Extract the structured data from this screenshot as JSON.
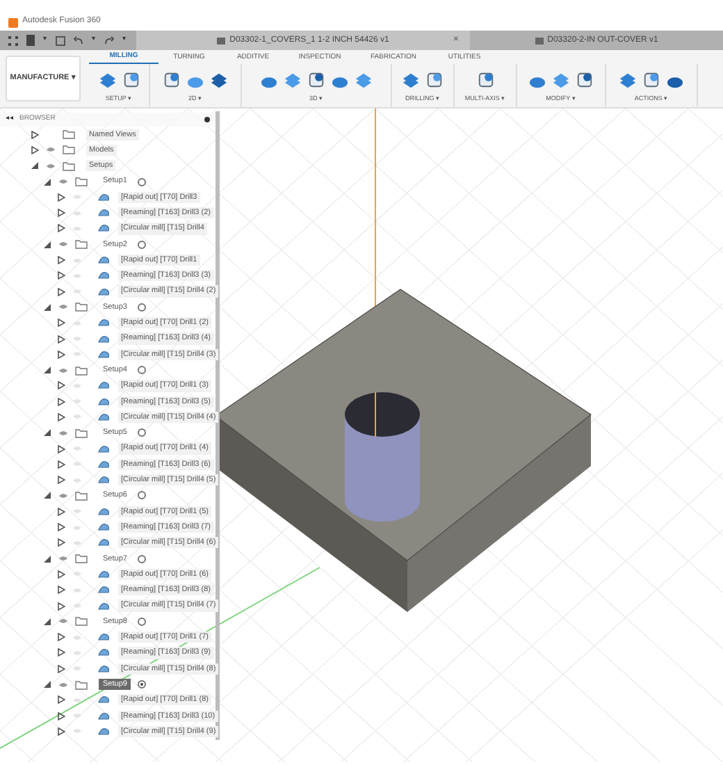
{
  "app_title": "Autodesk Fusion 360",
  "quick_access_carets": [
    "▾",
    "▾",
    "▾"
  ],
  "documents": [
    {
      "title": "D03302-1_COVERS_1 1-2 INCH 54426 v1",
      "selected": true,
      "close": "×"
    },
    {
      "title": "D03320-2-IN OUT-COVER v1",
      "selected": false
    }
  ],
  "workspace": {
    "label": "MANUFACTURE",
    "caret": "▾"
  },
  "tabs": [
    {
      "label": "MILLING",
      "selected": true
    },
    {
      "label": "TURNING",
      "selected": false
    },
    {
      "label": "ADDITIVE",
      "selected": false
    },
    {
      "label": "INSPECTION",
      "selected": false
    },
    {
      "label": "FABRICATION",
      "selected": false
    },
    {
      "label": "UTILITIES",
      "selected": false
    }
  ],
  "tool_groups": [
    {
      "label": "SETUP ▾"
    },
    {
      "label": "2D ▾"
    },
    {
      "label": "3D ▾"
    },
    {
      "label": "DRILLING ▾"
    },
    {
      "label": "MULTI-AXIS ▾"
    },
    {
      "label": "MODIFY ▾"
    },
    {
      "label": "ACTIONS ▾"
    }
  ],
  "browser": {
    "title": "BROWSER",
    "collapse": "◂◂",
    "items": [
      {
        "kind": "folder",
        "label": "Named Views",
        "expanded": false
      },
      {
        "kind": "folder",
        "label": "Models",
        "expanded": false
      },
      {
        "kind": "folder",
        "label": "Setups",
        "expanded": true,
        "children": [
          {
            "kind": "setup",
            "label": "Setup1",
            "expanded": true,
            "selected": false,
            "active": false,
            "children": [
              {
                "kind": "operation",
                "label": "[Rapid out] [T70] Drill3",
                "expanded": false
              },
              {
                "kind": "operation",
                "label": "[Reaming] [T163] Drill3 (2)",
                "expanded": false
              },
              {
                "kind": "operation",
                "label": "[Circular mill] [T15] Drill4",
                "expanded": false
              }
            ]
          },
          {
            "kind": "setup",
            "label": "Setup2",
            "expanded": true,
            "selected": false,
            "active": false,
            "children": [
              {
                "kind": "operation",
                "label": "[Rapid out] [T70] Drill1",
                "expanded": false
              },
              {
                "kind": "operation",
                "label": "[Reaming] [T163] Drill3 (3)",
                "expanded": false
              },
              {
                "kind": "operation",
                "label": "[Circular mill] [T15] Drill4 (2)",
                "expanded": false
              }
            ]
          },
          {
            "kind": "setup",
            "label": "Setup3",
            "expanded": true,
            "selected": false,
            "active": false,
            "children": [
              {
                "kind": "operation",
                "label": "[Rapid out] [T70] Drill1 (2)",
                "expanded": false
              },
              {
                "kind": "operation",
                "label": "[Reaming] [T163] Drill3 (4)",
                "expanded": false
              },
              {
                "kind": "operation",
                "label": "[Circular mill] [T15] Drill4 (3)",
                "expanded": false
              }
            ]
          },
          {
            "kind": "setup",
            "label": "Setup4",
            "expanded": true,
            "selected": false,
            "active": false,
            "children": [
              {
                "kind": "operation",
                "label": "[Rapid out] [T70] Drill1 (3)",
                "expanded": false
              },
              {
                "kind": "operation",
                "label": "[Reaming] [T163] Drill3 (5)",
                "expanded": false
              },
              {
                "kind": "operation",
                "label": "[Circular mill] [T15] Drill4 (4)",
                "expanded": false
              }
            ]
          },
          {
            "kind": "setup",
            "label": "Setup5",
            "expanded": true,
            "selected": false,
            "active": false,
            "children": [
              {
                "kind": "operation",
                "label": "[Rapid out] [T70] Drill1 (4)",
                "expanded": false
              },
              {
                "kind": "operation",
                "label": "[Reaming] [T163] Drill3 (6)",
                "expanded": false
              },
              {
                "kind": "operation",
                "label": "[Circular mill] [T15] Drill4 (5)",
                "expanded": false
              }
            ]
          },
          {
            "kind": "setup",
            "label": "Setup6",
            "expanded": true,
            "selected": false,
            "active": false,
            "children": [
              {
                "kind": "operation",
                "label": "[Rapid out] [T70] Drill1 (5)",
                "expanded": false
              },
              {
                "kind": "operation",
                "label": "[Reaming] [T163] Drill3 (7)",
                "expanded": false
              },
              {
                "kind": "operation",
                "label": "[Circular mill] [T15] Drill4 (6)",
                "expanded": false
              }
            ]
          },
          {
            "kind": "setup",
            "label": "Setup7",
            "expanded": true,
            "selected": false,
            "active": false,
            "children": [
              {
                "kind": "operation",
                "label": "[Rapid out] [T70] Drill1 (6)",
                "expanded": false
              },
              {
                "kind": "operation",
                "label": "[Reaming] [T163] Drill3 (8)",
                "expanded": false
              },
              {
                "kind": "operation",
                "label": "[Circular mill] [T15] Drill4 (7)",
                "expanded": false
              }
            ]
          },
          {
            "kind": "setup",
            "label": "Setup8",
            "expanded": true,
            "selected": false,
            "active": false,
            "children": [
              {
                "kind": "operation",
                "label": "[Rapid out] [T70] Drill1 (7)",
                "expanded": false
              },
              {
                "kind": "operation",
                "label": "[Reaming] [T163] Drill3 (9)",
                "expanded": false
              },
              {
                "kind": "operation",
                "label": "[Circular mill] [T15] Drill4 (8)",
                "expanded": false
              }
            ]
          },
          {
            "kind": "setup",
            "label": "Setup9",
            "expanded": true,
            "selected": true,
            "active": true,
            "children": [
              {
                "kind": "operation",
                "label": "[Rapid out] [T70] Drill1 (8)",
                "expanded": false
              },
              {
                "kind": "operation",
                "label": "[Reaming] [T163] Drill3 (10)",
                "expanded": false
              },
              {
                "kind": "operation",
                "label": "[Circular mill] [T15] Drill4 (9)",
                "expanded": false
              }
            ]
          }
        ]
      }
    ]
  }
}
